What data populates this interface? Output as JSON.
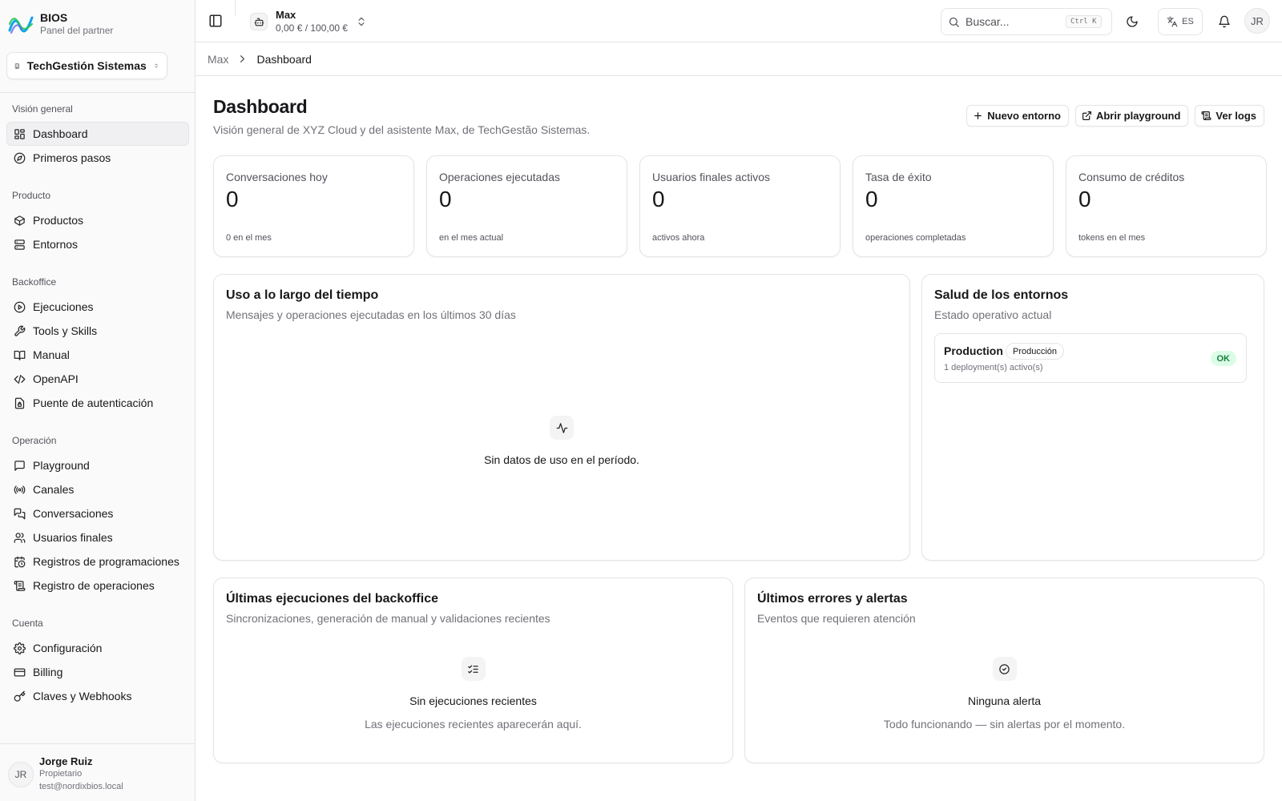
{
  "app": {
    "brand_name": "BIOS",
    "brand_subtitle": "Panel del partner",
    "org_name": "TechGestión Sistemas"
  },
  "sidebar": {
    "groups": [
      {
        "label": "Visión general",
        "items": [
          {
            "label": "Dashboard",
            "icon": "dashboard-icon",
            "active": true
          },
          {
            "label": "Primeros pasos",
            "icon": "compass-icon"
          }
        ]
      },
      {
        "label": "Producto",
        "items": [
          {
            "label": "Productos",
            "icon": "package-icon"
          },
          {
            "label": "Entornos",
            "icon": "server-icon"
          }
        ]
      },
      {
        "label": "Backoffice",
        "items": [
          {
            "label": "Ejecuciones",
            "icon": "play-circle-icon"
          },
          {
            "label": "Tools y Skills",
            "icon": "wrench-icon"
          },
          {
            "label": "Manual",
            "icon": "book-open-icon"
          },
          {
            "label": "OpenAPI",
            "icon": "code-icon"
          },
          {
            "label": "Puente de autenticación",
            "icon": "file-lock-icon"
          }
        ]
      },
      {
        "label": "Operación",
        "items": [
          {
            "label": "Playground",
            "icon": "message-square-icon"
          },
          {
            "label": "Canales",
            "icon": "radio-icon"
          },
          {
            "label": "Conversaciones",
            "icon": "messages-icon"
          },
          {
            "label": "Usuarios finales",
            "icon": "users-icon"
          },
          {
            "label": "Registros de programaciones",
            "icon": "calendar-clock-icon"
          },
          {
            "label": "Registro de operaciones",
            "icon": "scroll-text-icon"
          }
        ]
      },
      {
        "label": "Cuenta",
        "items": [
          {
            "label": "Configuración",
            "icon": "settings-icon"
          },
          {
            "label": "Billing",
            "icon": "credit-card-icon"
          },
          {
            "label": "Claves y Webhooks",
            "icon": "key-icon"
          }
        ]
      }
    ]
  },
  "user": {
    "initials": "JR",
    "name": "Jorge Ruiz",
    "role": "Propietario",
    "email": "test@nordixbios.local"
  },
  "topbar": {
    "agent_name": "Max",
    "agent_credit": "0,00 € / 100,00 €",
    "search_placeholder": "Buscar...",
    "search_shortcut": "Ctrl K",
    "lang": "ES",
    "avatar_initials": "JR"
  },
  "breadcrumb": {
    "parent": "Max",
    "current": "Dashboard"
  },
  "page": {
    "title": "Dashboard",
    "subtitle": "Visión general de XYZ Cloud y del asistente Max, de TechGestão Sistemas.",
    "actions": {
      "new_env": "Nuevo entorno",
      "open_playground": "Abrir playground",
      "view_logs": "Ver logs"
    }
  },
  "stats": [
    {
      "label": "Conversaciones hoy",
      "value": "0",
      "hint": "0 en el mes"
    },
    {
      "label": "Operaciones ejecutadas",
      "value": "0",
      "hint": "en el mes actual"
    },
    {
      "label": "Usuarios finales activos",
      "value": "0",
      "hint": "activos ahora"
    },
    {
      "label": "Tasa de éxito",
      "value": "0",
      "hint": "operaciones completadas"
    },
    {
      "label": "Consumo de créditos",
      "value": "0",
      "hint": "tokens en el mes"
    }
  ],
  "usage": {
    "title": "Uso a lo largo del tiempo",
    "subtitle": "Mensajes y operaciones ejecutadas en los últimos 30 días",
    "empty": "Sin datos de uso en el período."
  },
  "health": {
    "title": "Salud de los entornos",
    "subtitle": "Estado operativo actual",
    "env": {
      "name": "Production",
      "tag": "Producción",
      "deployments": "1 deployment(s) activo(s)",
      "status": "OK",
      "status_color": "#15803d"
    }
  },
  "executions": {
    "title": "Últimas ejecuciones del backoffice",
    "subtitle": "Sincronizaciones, generación de manual y validaciones recientes",
    "empty_title": "Sin ejecuciones recientes",
    "empty_desc": "Las ejecuciones recientes aparecerán aquí."
  },
  "alerts": {
    "title": "Últimos errores y alertas",
    "subtitle": "Eventos que requieren atención",
    "empty_title": "Ninguna alerta",
    "empty_desc": "Todo funcionando — sin alertas por el momento."
  }
}
